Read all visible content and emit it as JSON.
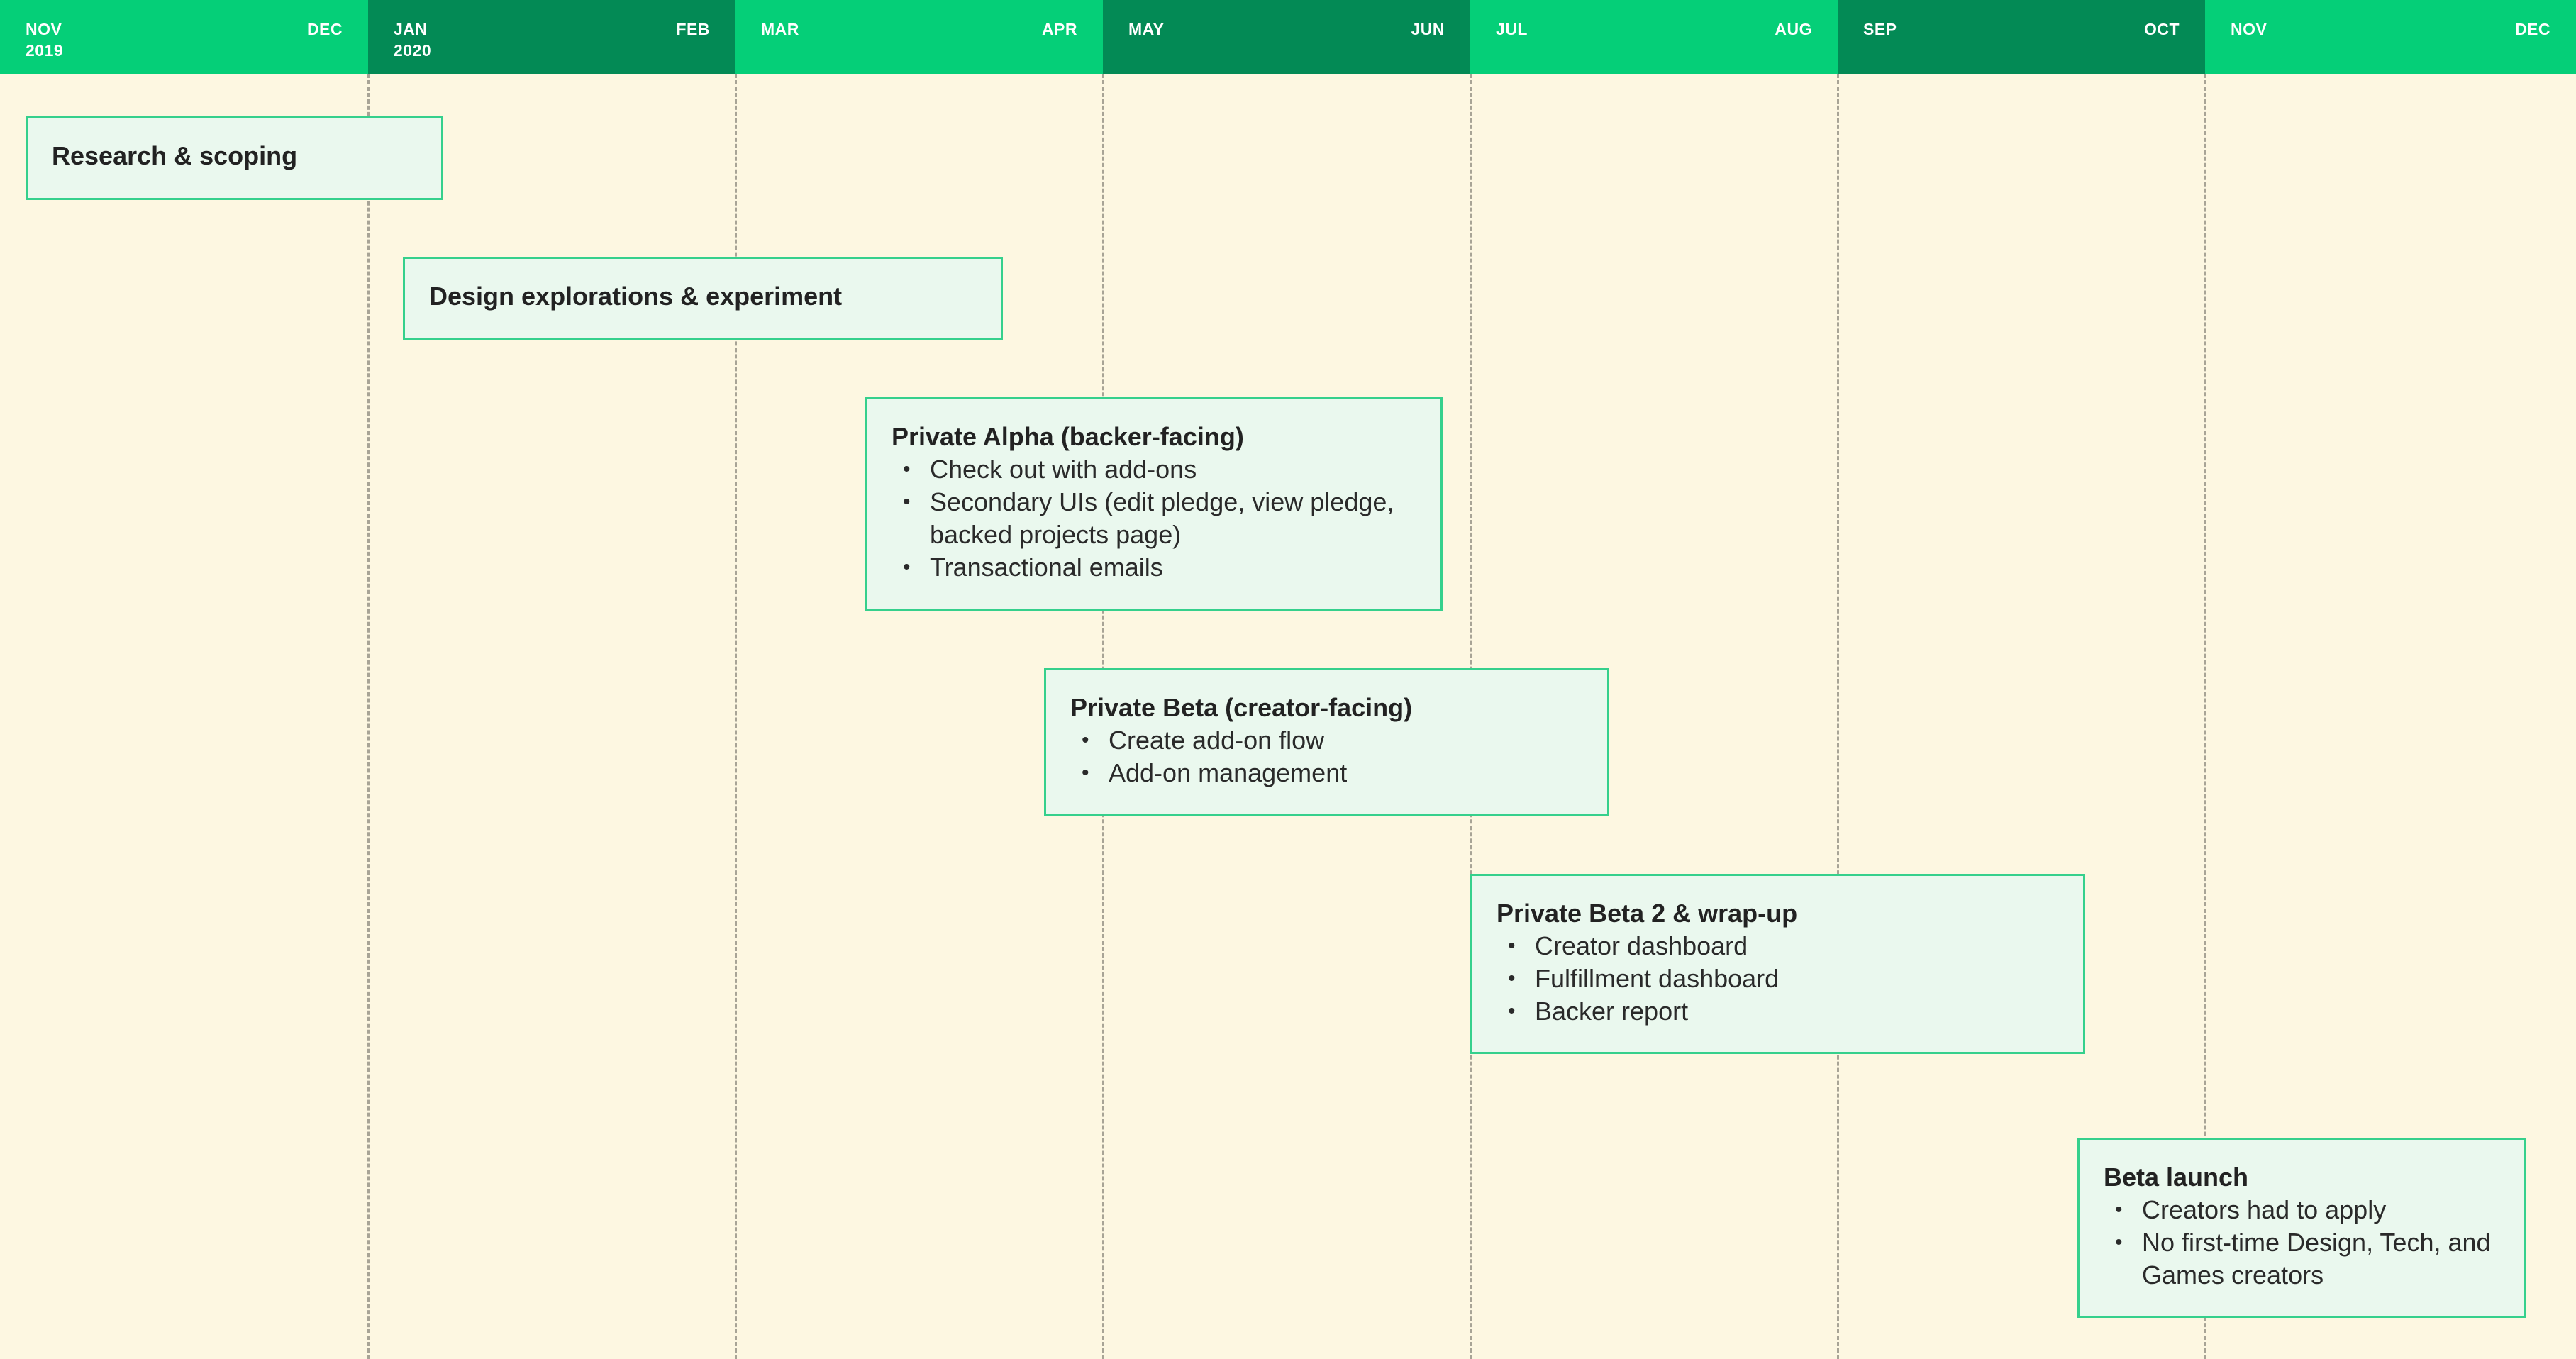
{
  "periods": [
    {
      "start": "NOV",
      "year": "2019",
      "end": "DEC",
      "shade": "light"
    },
    {
      "start": "JAN",
      "year": "2020",
      "end": "FEB",
      "shade": "dark"
    },
    {
      "start": "MAR",
      "year": "",
      "end": "APR",
      "shade": "light"
    },
    {
      "start": "MAY",
      "year": "",
      "end": "JUN",
      "shade": "dark"
    },
    {
      "start": "JUL",
      "year": "",
      "end": "AUG",
      "shade": "light"
    },
    {
      "start": "SEP",
      "year": "",
      "end": "OCT",
      "shade": "dark"
    },
    {
      "start": "NOV",
      "year": "",
      "end": "DEC",
      "shade": "light"
    }
  ],
  "phases": [
    {
      "title": "Research & scoping",
      "items": []
    },
    {
      "title": "Design explorations & experiment",
      "items": []
    },
    {
      "title": "Private Alpha (backer-facing)",
      "items": [
        "Check out with add-ons",
        "Secondary UIs (edit pledge, view pledge, backed projects page)",
        "Transactional emails"
      ]
    },
    {
      "title": "Private Beta (creator-facing)",
      "items": [
        "Create add-on flow",
        "Add-on management"
      ]
    },
    {
      "title": "Private Beta 2 & wrap-up",
      "items": [
        "Creator dashboard",
        "Fulfillment dashboard",
        "Backer report"
      ]
    },
    {
      "title": "Beta launch",
      "items": [
        "Creators had to apply",
        "No first-time Design, Tech, and Games creators"
      ]
    }
  ],
  "colors": {
    "background": "#fdf7e1",
    "header_light": "#05cf78",
    "header_dark": "#038a55",
    "card_fill": "#eaf8ee",
    "card_border": "#35d08c",
    "divider": "#a8a496"
  },
  "bullet_glyph": "•"
}
